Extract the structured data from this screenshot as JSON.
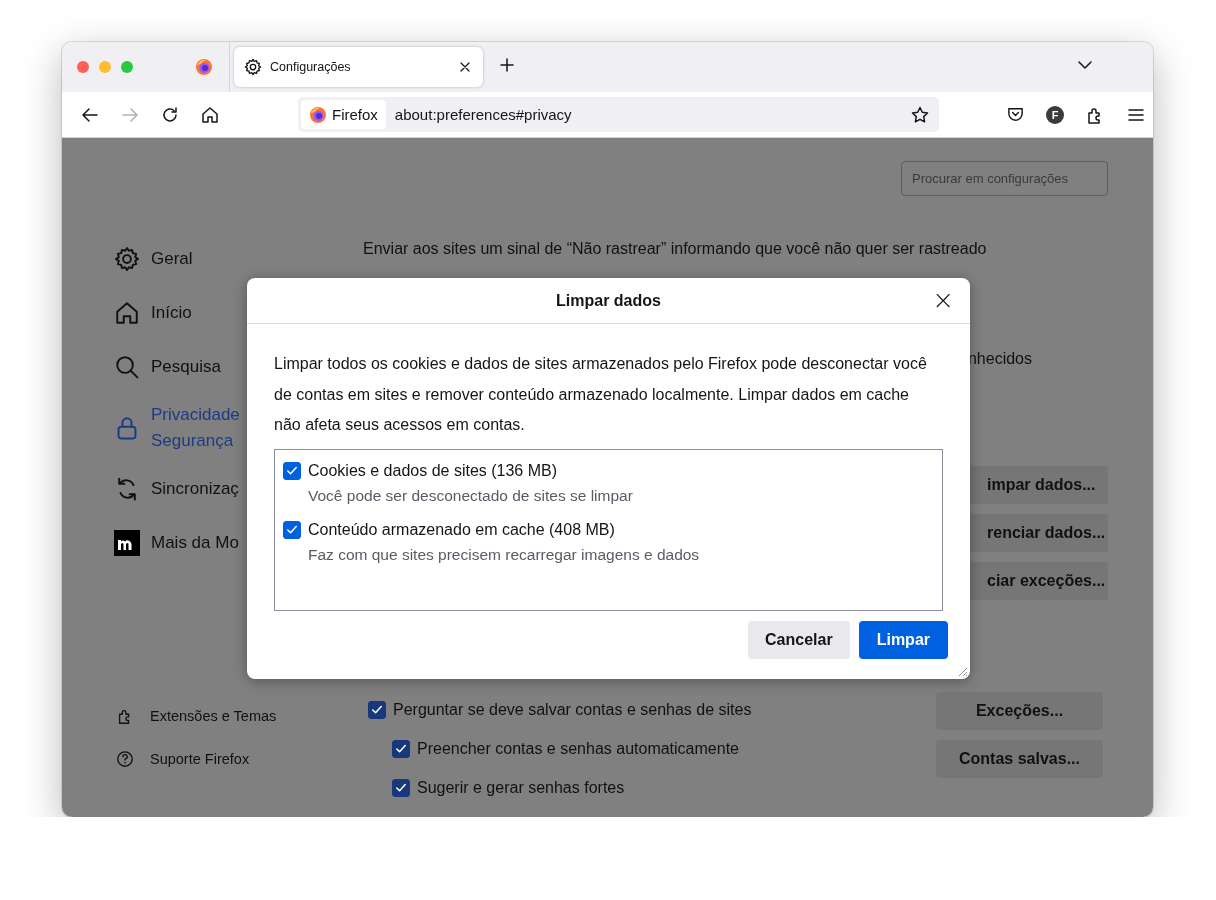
{
  "tabs": [
    {
      "kind": "pinned",
      "selected": false
    },
    {
      "kind": "page",
      "label": "Configurações",
      "selected": true
    }
  ],
  "toolbar": {
    "identity": "Firefox",
    "url": "about:preferences#privacy",
    "account_initial": "F"
  },
  "preferences": {
    "search": {
      "placeholder": "Procurar em configurações"
    },
    "sidebar": [
      {
        "label": "Geral",
        "selected": false
      },
      {
        "label": "Início",
        "selected": false
      },
      {
        "label": "Pesquisa",
        "selected": false
      },
      {
        "label": "Privacidade",
        "label_2": "Segurança",
        "selected": true
      },
      {
        "label": "Sincronizaç",
        "selected": false
      },
      {
        "label": "Mais da Mo",
        "selected": false
      }
    ],
    "sidebar_footer": [
      "Extensões e Temas",
      "Suporte Firefox"
    ],
    "dnt_text": "Enviar aos sites um sinal de “Não rastrear” informando que você não quer ser rastreado",
    "partial_text": "nhecidos",
    "data_buttons": [
      "impar dados...",
      "renciar dados...",
      "ciar exceções..."
    ],
    "logins": [
      {
        "label": "Perguntar se deve salvar contas e senhas de sites",
        "checked": true,
        "children": [
          {
            "label": "Preencher contas e senhas automaticamente",
            "checked": true
          },
          {
            "label": "Sugerir e gerar senhas fortes",
            "checked": true
          }
        ]
      }
    ],
    "logins_buttons": [
      "Exceções...",
      "Contas salvas..."
    ]
  },
  "dialog": {
    "title": "Limpar dados",
    "close": "×",
    "description": "Limpar todos os cookies e dados de sites armazenados pelo Firefox pode desconectar você de contas em sites e remover conteúdo armazenado localmente. Limpar dados em cache não afeta seus acessos em contas.",
    "options": [
      {
        "label": "Cookies e dados de sites (136 MB)",
        "detail": "Você pode ser desconectado de sites se limpar",
        "checked": true
      },
      {
        "label": "Conteúdo armazenado em cache (408 MB)",
        "detail": "Faz com que sites precisem recarregar imagens e dados",
        "checked": true
      }
    ],
    "buttons": [
      {
        "label": "Cancelar",
        "kind": "secondary"
      },
      {
        "label": "Limpar",
        "kind": "primary"
      }
    ]
  }
}
